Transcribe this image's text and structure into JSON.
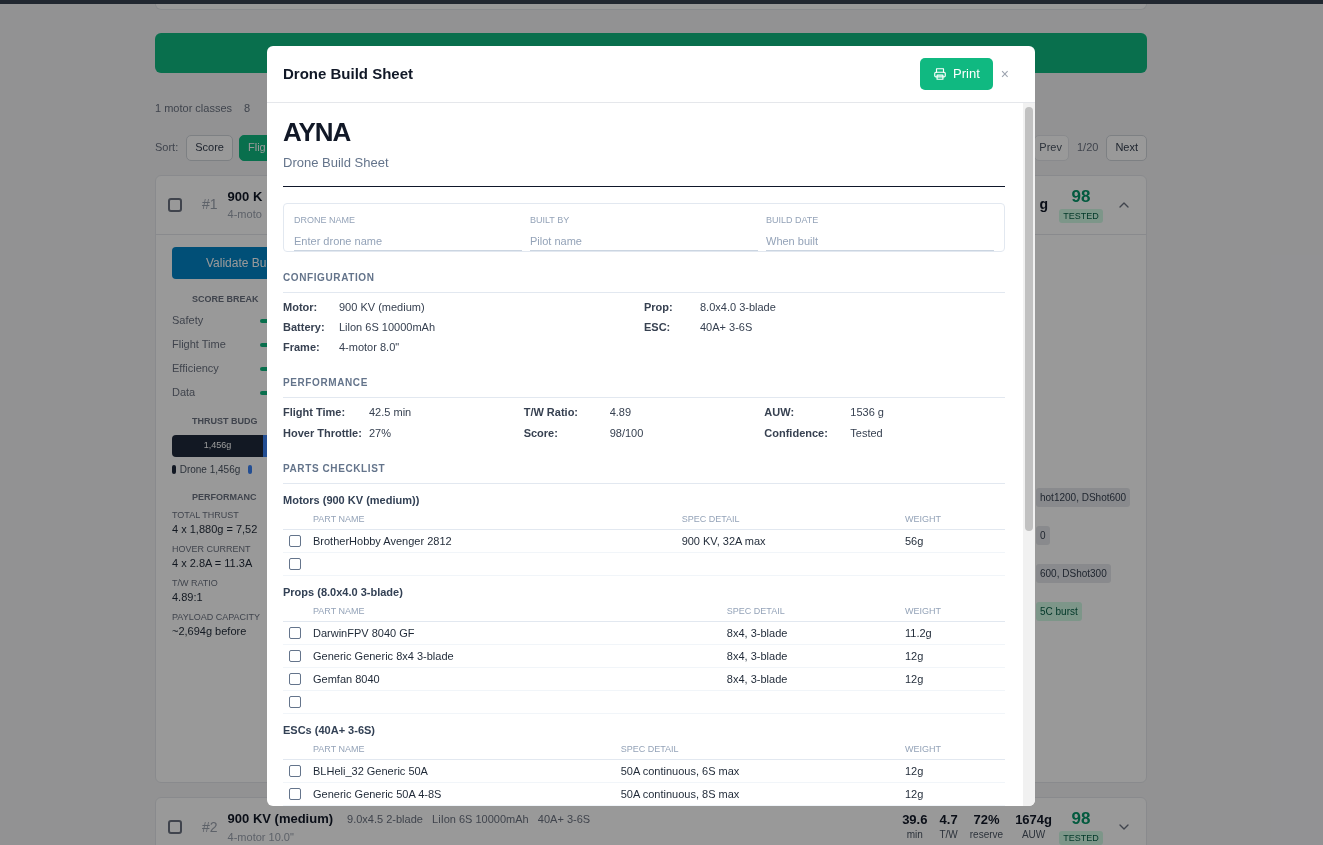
{
  "background": {
    "summary": [
      "1 motor classes",
      "8"
    ],
    "sort": {
      "label": "Sort:",
      "options": [
        {
          "label": "Score",
          "selected": false
        },
        {
          "label": "Flig",
          "selected": true
        }
      ]
    },
    "pager": {
      "prev": "Prev",
      "page": "1/20",
      "next": "Next"
    },
    "builds": [
      {
        "rank": "#1",
        "selected": false,
        "title": "900 K",
        "subtitle": "4-moto",
        "weight_tail": "g",
        "score": "98",
        "badge": "TESTED",
        "expanded": true,
        "validate": "Validate Bu",
        "score_heading": "SCORE BREAK",
        "score_rows": [
          "Safety",
          "Flight Time",
          "Efficiency",
          "Data"
        ],
        "thrust_heading": "THRUST BUDG",
        "thrust_bar": "1,456g",
        "legend": "Drone 1,456g",
        "perf_heading": "PERFORMANC",
        "perf": [
          {
            "label": "TOTAL THRUST",
            "value": "4 x 1,880g = 7,52"
          },
          {
            "label": "HOVER CURRENT",
            "value": "4 x 2.8A = 11.3A"
          },
          {
            "label": "T/W RATIO",
            "value": "4.89:1"
          },
          {
            "label": "PAYLOAD CAPACITY",
            "value": "~2,694g before"
          }
        ],
        "tags": [
          {
            "text": "hot1200, DShot600",
            "kind": "gray"
          },
          {
            "text": "0",
            "kind": "gray"
          },
          {
            "text": "600, DShot300",
            "kind": "gray"
          },
          {
            "text": "5C burst",
            "kind": "green"
          }
        ]
      },
      {
        "rank": "#2",
        "selected": false,
        "title": "900 KV (medium)",
        "specs": "9.0x4.5 2-blade   LiIon 6S 10000mAh   40A+ 3-6S",
        "subtitle": "4-motor 10.0\"",
        "stats": [
          {
            "value": "39.6",
            "unit": "min"
          },
          {
            "value": "4.7",
            "unit": "T/W"
          },
          {
            "value": "72%",
            "unit": "reserve"
          },
          {
            "value": "1674g",
            "unit": "AUW"
          }
        ],
        "score": "98",
        "badge": "TESTED",
        "expanded": false
      }
    ]
  },
  "modal": {
    "title": "Drone Build Sheet",
    "print": "Print",
    "close": "×",
    "logo": "AYNA",
    "subtitle": "Drone Build Sheet",
    "fields": [
      {
        "label": "DRONE NAME",
        "placeholder": "Enter drone name"
      },
      {
        "label": "BUILT BY",
        "placeholder": "Pilot name"
      },
      {
        "label": "BUILD DATE",
        "placeholder": "When built"
      }
    ],
    "configuration": {
      "heading": "CONFIGURATION",
      "left": [
        {
          "label": "Motor:",
          "value": "900 KV (medium)"
        },
        {
          "label": "Battery:",
          "value": "Lilon 6S 10000mAh"
        },
        {
          "label": "Frame:",
          "value": "4-motor 8.0\""
        }
      ],
      "right": [
        {
          "label": "Prop:",
          "value": "8.0x4.0 3-blade"
        },
        {
          "label": "ESC:",
          "value": "40A+ 3-6S"
        }
      ]
    },
    "performance": {
      "heading": "PERFORMANCE",
      "columns": [
        [
          {
            "label": "Flight Time:",
            "value": "42.5 min"
          },
          {
            "label": "Hover Throttle:",
            "value": "27%"
          }
        ],
        [
          {
            "label": "T/W Ratio:",
            "value": "4.89"
          },
          {
            "label": "Score:",
            "value": "98/100"
          }
        ],
        [
          {
            "label": "AUW:",
            "value": "1536 g"
          },
          {
            "label": "Confidence:",
            "value": "Tested"
          }
        ]
      ]
    },
    "checklist": {
      "heading": "PARTS CHECKLIST",
      "groups": [
        {
          "title": "Motors (900 KV (medium))",
          "columns": [
            "PART NAME",
            "SPEC DETAIL",
            "WEIGHT"
          ],
          "rows": [
            {
              "kind": "part",
              "checked": false,
              "cells": [
                "BrotherHobby Avenger 2812",
                "900 KV, 32A max",
                "56g"
              ]
            },
            {
              "kind": "blank",
              "checked": false
            }
          ]
        },
        {
          "title": "Props (8.0x4.0 3-blade)",
          "columns": [
            "PART NAME",
            "SPEC DETAIL",
            "WEIGHT"
          ],
          "rows": [
            {
              "kind": "part",
              "checked": false,
              "cells": [
                "DarwinFPV 8040 GF",
                "8x4, 3-blade",
                "11.2g"
              ]
            },
            {
              "kind": "part",
              "checked": false,
              "cells": [
                "Generic Generic 8x4 3-blade",
                "8x4, 3-blade",
                "12g"
              ]
            },
            {
              "kind": "part",
              "checked": false,
              "cells": [
                "Gemfan 8040",
                "8x4, 3-blade",
                "12g"
              ]
            },
            {
              "kind": "blank",
              "checked": false
            }
          ]
        },
        {
          "title": "ESCs (40A+ 3-6S)",
          "columns": [
            "PART NAME",
            "SPEC DETAIL",
            "WEIGHT"
          ],
          "rows": [
            {
              "kind": "part",
              "checked": false,
              "cells": [
                "BLHeli_32 Generic 50A",
                "50A continuous, 6S max",
                "12g"
              ]
            },
            {
              "kind": "part",
              "checked": false,
              "cells": [
                "Generic Generic 50A 4-8S",
                "50A continuous, 8S max",
                "12g"
              ]
            }
          ]
        }
      ]
    }
  }
}
